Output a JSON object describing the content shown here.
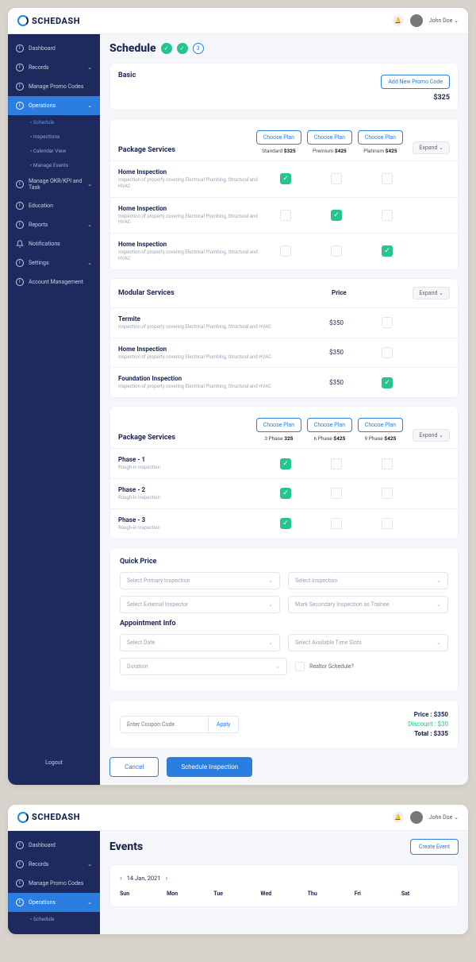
{
  "brand": "SCHEDASH",
  "user": {
    "name": "John Doe ⌄"
  },
  "sidebar": {
    "items": [
      {
        "label": "Dashboard",
        "hasCaret": false
      },
      {
        "label": "Records",
        "hasCaret": true
      },
      {
        "label": "Manage Promo Codes",
        "hasCaret": false
      },
      {
        "label": "Operations",
        "hasCaret": true,
        "active": true,
        "subs": [
          {
            "label": "Schedule",
            "active": true
          },
          {
            "label": "Inspections"
          },
          {
            "label": "Calendar View"
          },
          {
            "label": "Manage Events"
          }
        ]
      },
      {
        "label": "Manage OKR/KPI and Task",
        "hasCaret": true
      },
      {
        "label": "Education",
        "hasCaret": false
      },
      {
        "label": "Reports",
        "hasCaret": true
      },
      {
        "label": "Notifications",
        "hasCaret": false,
        "icon": "bell"
      },
      {
        "label": "Settings",
        "hasCaret": true
      },
      {
        "label": "Account Management",
        "hasCaret": false
      }
    ],
    "logout": "Logout"
  },
  "schedule": {
    "title": "Schedule",
    "step3": "3",
    "basic": {
      "label": "Basic",
      "addBtn": "Add New Promo Code",
      "price": "$325"
    },
    "expand": "Expand ⌄",
    "choosePlan": "Choose Plan",
    "pkg1": {
      "title": "Package Services",
      "cols": [
        {
          "name": "Standard",
          "price": "$325"
        },
        {
          "name": "Premium",
          "price": "$425"
        },
        {
          "name": "Platinum",
          "price": "$425"
        }
      ],
      "rows": [
        {
          "name": "Home Inspection",
          "desc": "Inspection of property covering Electrical Plumbing, Structural and HVAC",
          "checks": [
            true,
            false,
            false
          ]
        },
        {
          "name": "Home Inspection",
          "desc": "Inspection of property covering Electrical Plumbing, Structural and HVAC",
          "checks": [
            false,
            true,
            false
          ]
        },
        {
          "name": "Home Inspection",
          "desc": "Inspection of property covering Electrical Plumbing, Structural and HVAC",
          "checks": [
            false,
            false,
            true
          ]
        }
      ]
    },
    "modular": {
      "title": "Modular Services",
      "priceLabel": "Price",
      "rows": [
        {
          "name": "Termite",
          "desc": "Inspection of property covering Electrical Plumbing, Structural and HVAC",
          "price": "$350",
          "check": false
        },
        {
          "name": "Home Inspection",
          "desc": "Inspection of property covering Electrical Plumbing, Structural and HVAC",
          "price": "$350",
          "check": false
        },
        {
          "name": "Foundation Inspection",
          "desc": "Inspection of property covering Electrical Plumbing, Structural and HVAC",
          "price": "$350",
          "check": true
        }
      ]
    },
    "pkg2": {
      "title": "Package Services",
      "cols": [
        {
          "name": "3 Phase",
          "price": "325"
        },
        {
          "name": "6 Phase",
          "price": "$425"
        },
        {
          "name": "9 Phase",
          "price": "$425"
        }
      ],
      "rows": [
        {
          "name": "Phase - 1",
          "desc": "Rough-in Inspection",
          "checks": [
            true,
            false,
            false
          ]
        },
        {
          "name": "Phase - 2",
          "desc": "Rough-in Inspection",
          "checks": [
            true,
            false,
            false
          ]
        },
        {
          "name": "Phase - 3",
          "desc": "Rough-in Inspection",
          "checks": [
            true,
            false,
            false
          ]
        }
      ]
    },
    "quick": {
      "title": "Quick Price",
      "selectPrimary": "Select Primary Inspection",
      "selectInspection": "Select Inspection",
      "selectExternal": "Select External Inspector",
      "markSecondary": "Mark Secondary Inspection as Trainee",
      "apptTitle": "Appointment Info",
      "selectDate": "Select Date",
      "selectSlots": "Select Available Time Slots",
      "duration": "Duration",
      "realtor": "Realtor Schedule?"
    },
    "totals": {
      "couponPh": "Enter Coupon Code",
      "apply": "Apply",
      "priceLabel": "Price :",
      "price": "$350",
      "discountLabel": "Discount :",
      "discount": "$30",
      "totalLabel": "Total :",
      "total": "$335"
    },
    "actions": {
      "cancel": "Cancel",
      "submit": "Schedule Inspection"
    }
  },
  "events": {
    "title": "Events",
    "createBtn": "Create Event",
    "date": "14 Jan, 2021",
    "days": [
      "Sun",
      "Mon",
      "Tue",
      "Wed",
      "Thu",
      "Fri",
      "Sat"
    ]
  },
  "sidebar2": {
    "items": [
      {
        "label": "Dashboard"
      },
      {
        "label": "Records",
        "hasCaret": true
      },
      {
        "label": "Manage Promo Codes"
      },
      {
        "label": "Operations",
        "hasCaret": true,
        "active": true,
        "subs": [
          {
            "label": "Schedule"
          }
        ]
      }
    ]
  }
}
